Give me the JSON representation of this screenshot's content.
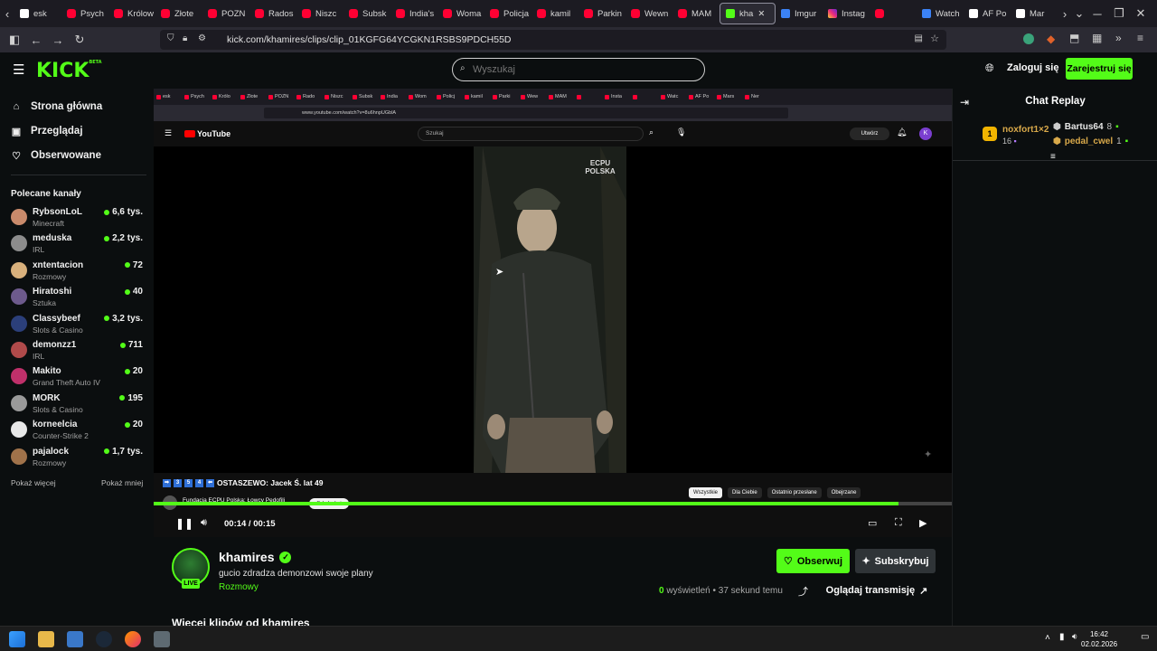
{
  "browser": {
    "tabs": [
      {
        "label": "esk",
        "icon": "x"
      },
      {
        "label": "Psych",
        "icon": "yt"
      },
      {
        "label": "Królow",
        "icon": "yt"
      },
      {
        "label": "Złote",
        "icon": "yt"
      },
      {
        "label": "POZN",
        "icon": "yt"
      },
      {
        "label": "Rados",
        "icon": "yt"
      },
      {
        "label": "Niszc",
        "icon": "yt"
      },
      {
        "label": "Subsk",
        "icon": "yt"
      },
      {
        "label": "India's",
        "icon": "yt"
      },
      {
        "label": "Woma",
        "icon": "yt"
      },
      {
        "label": "Policja",
        "icon": "yt"
      },
      {
        "label": "kamil",
        "icon": "yt"
      },
      {
        "label": "Parkin",
        "icon": "yt"
      },
      {
        "label": "Wewn",
        "icon": "yt"
      },
      {
        "label": "MAM",
        "icon": "yt"
      },
      {
        "label": "kha",
        "icon": "kk",
        "active": true
      },
      {
        "label": "Imgur",
        "icon": "bl"
      },
      {
        "label": "Instag",
        "icon": "ig"
      },
      {
        "label": "",
        "icon": "yt"
      },
      {
        "label": "Watch",
        "icon": "bl"
      },
      {
        "label": "AF Po",
        "icon": "x"
      },
      {
        "label": "Mar",
        "icon": "x"
      }
    ],
    "url": "kick.com/khamires/clips/clip_01KGFG64YCGKN1RSBS9PDCH55D"
  },
  "header": {
    "logo": "KICK",
    "logo_badge": "BETA",
    "search_placeholder": "Wyszukaj",
    "login": "Zaloguj się",
    "signup": "Zarejestruj się"
  },
  "sidebar": {
    "nav": [
      {
        "label": "Strona główna",
        "icon": "home-icon"
      },
      {
        "label": "Przeglądaj",
        "icon": "browse-icon"
      },
      {
        "label": "Obserwowane",
        "icon": "heart-icon"
      }
    ],
    "recommended_title": "Polecane kanały",
    "channels": [
      {
        "name": "RybsonLoL",
        "category": "Minecraft",
        "viewers": "6,6 tys.",
        "color": "#c98a6b"
      },
      {
        "name": "meduska",
        "category": "IRL",
        "viewers": "2,2 tys.",
        "color": "#8c8c8c"
      },
      {
        "name": "xntentacion",
        "category": "Rozmowy",
        "viewers": "72",
        "color": "#d8b07c"
      },
      {
        "name": "Hiratoshi",
        "category": "Sztuka",
        "viewers": "40",
        "color": "#6d5a8c"
      },
      {
        "name": "Classybeef",
        "category": "Slots & Casino",
        "viewers": "3,2 tys.",
        "color": "#2b3f7a"
      },
      {
        "name": "demonzz1",
        "category": "IRL",
        "viewers": "711",
        "color": "#b04a4a"
      },
      {
        "name": "Makito",
        "category": "Grand Theft Auto IV",
        "viewers": "20",
        "color": "#c0306a"
      },
      {
        "name": "MORK",
        "category": "Slots & Casino",
        "viewers": "195",
        "color": "#9a9a9a"
      },
      {
        "name": "korneelcia",
        "category": "Counter-Strike 2",
        "viewers": "20",
        "color": "#e8e8e8"
      },
      {
        "name": "pajalock",
        "category": "Rozmowy",
        "viewers": "1,7 tys.",
        "color": "#a0724a"
      }
    ],
    "show_more": "Pokaż więcej",
    "show_less": "Pokaż mniej"
  },
  "video": {
    "inner_tabs": [
      "esk",
      "Psych",
      "Królo",
      "Złote",
      "POZN",
      "Rado",
      "Niszc",
      "Subsk",
      "India",
      "Wom",
      "Policj",
      "kamil",
      "Parki",
      "Wew",
      "MAM",
      "",
      "Insta",
      "",
      "Watc",
      "AF Po",
      "Mars",
      "Ner"
    ],
    "inner_url": "www.youtube.com/watch?v=8u6hnpUGblA",
    "yt_logo": "YouTube",
    "yt_search": "Szukaj",
    "yt_create": "Utwórz",
    "yt_avatar": "K",
    "watermark": "ECPU POLSKA",
    "ticker_nums": [
      "3",
      "5",
      "4"
    ],
    "ticker": "OSTASZEWO: Jacek Ś. lat 49",
    "yt_channel": "Fundacja ECPU Polska: Łowcy Pedofili",
    "yt_subscribe": "Subskrybuj",
    "chips": [
      "Wszystkie",
      "Dla Ciebie",
      "Ostatnio przesłane",
      "Obejrzane"
    ],
    "progress": 0.933,
    "time": "00:14 / 00:15"
  },
  "channel": {
    "name": "khamires",
    "live": "LIVE",
    "clip_title": "gucio zdradza demonzowi swoje plany",
    "category": "Rozmowy",
    "follow": "Obserwuj",
    "subscribe": "Subskrybuj",
    "views_count": "0",
    "views_label": "wyświetleń",
    "ago": "37 sekund temu",
    "watch_stream": "Oglądaj transmisję",
    "more_clips": "Więcej klipów od khamires"
  },
  "chat": {
    "title": "Chat Replay",
    "leader": {
      "rank": "1",
      "name": "noxfort1×2",
      "count": "16"
    },
    "others": [
      {
        "name": "Bartus64",
        "count": "8",
        "color": "#e6e6e6"
      },
      {
        "name": "pedal_cwel",
        "count": "1",
        "color": "#d9a94a"
      }
    ]
  },
  "taskbar": {
    "time": "16:42",
    "date": "02.02.2026"
  }
}
